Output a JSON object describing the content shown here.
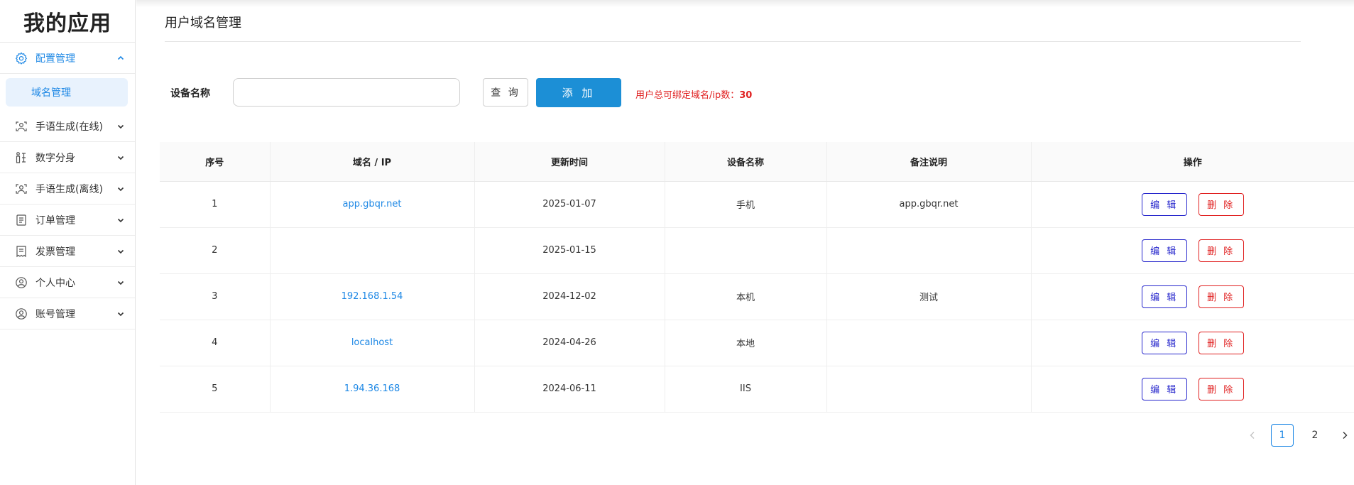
{
  "app": {
    "title": "我的应用"
  },
  "sidebar": {
    "items": [
      {
        "label": "配置管理",
        "icon": "settings-gear-icon",
        "expanded": true,
        "children": [
          {
            "label": "域名管理"
          }
        ]
      },
      {
        "label": "手语生成(在线)",
        "icon": "sign-language-icon"
      },
      {
        "label": "数字分身",
        "icon": "digital-avatar-icon"
      },
      {
        "label": "手语生成(离线)",
        "icon": "sign-language-icon"
      },
      {
        "label": "订单管理",
        "icon": "order-document-icon"
      },
      {
        "label": "发票管理",
        "icon": "invoice-icon"
      },
      {
        "label": "个人中心",
        "icon": "user-circle-icon"
      },
      {
        "label": "账号管理",
        "icon": "user-circle-icon"
      }
    ]
  },
  "page": {
    "title": "用户域名管理",
    "search": {
      "label": "设备名称",
      "value": "",
      "placeholder": ""
    },
    "query_label": "查 询",
    "add_label": "添 加",
    "quota": {
      "text": "用户总可绑定域名/ip数：",
      "value": "30"
    }
  },
  "table": {
    "headers": [
      "序号",
      "域名 / IP",
      "更新时间",
      "设备名称",
      "备注说明",
      "操作"
    ],
    "rows": [
      {
        "index": "1",
        "domain": "app.gbqr.net",
        "updated": "2025-01-07",
        "device": "手机",
        "note": "app.gbqr.net"
      },
      {
        "index": "2",
        "domain": "",
        "updated": "2025-01-15",
        "device": "",
        "note": ""
      },
      {
        "index": "3",
        "domain": "192.168.1.54",
        "updated": "2024-12-02",
        "device": "本机",
        "note": "测试"
      },
      {
        "index": "4",
        "domain": "localhost",
        "updated": "2024-04-26",
        "device": "本地",
        "note": ""
      },
      {
        "index": "5",
        "domain": "1.94.36.168",
        "updated": "2024-06-11",
        "device": "IIS",
        "note": ""
      }
    ],
    "edit_label": "编 辑",
    "delete_label": "删 除"
  },
  "pagination": {
    "pages": [
      "1",
      "2"
    ],
    "current": "1"
  },
  "colors": {
    "accent": "#1e88e5",
    "primary_button": "#1c8fd6",
    "danger": "#e02020",
    "edit": "#2626cc"
  }
}
